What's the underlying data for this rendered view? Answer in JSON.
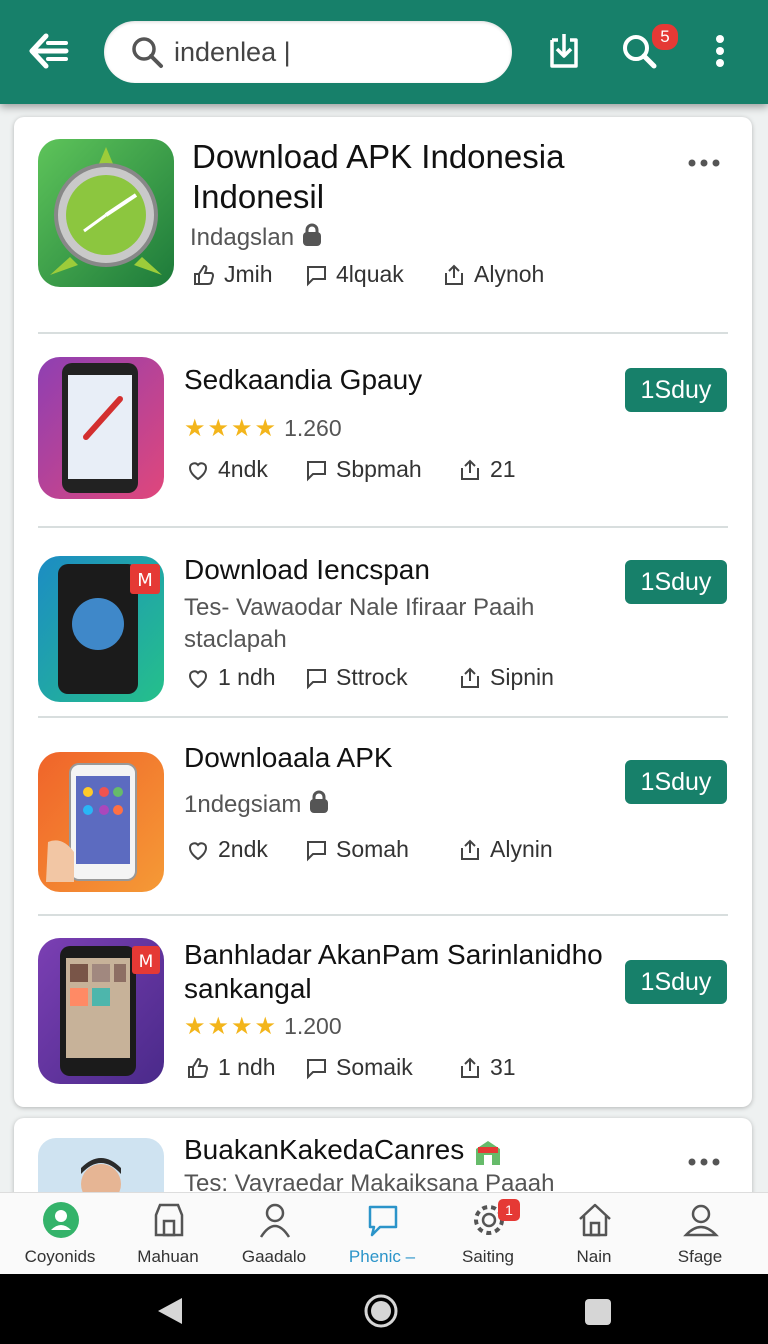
{
  "search": {
    "value": "indenlea |"
  },
  "toolbar": {
    "badge_count": "5"
  },
  "apps": [
    {
      "title": "Download APK Indonesia Indonesil",
      "subtitle": "Indagslan",
      "stats": [
        "Jmih",
        "4lquak",
        "Alynoh"
      ]
    },
    {
      "title": "Sedkaandia Gpauy",
      "rating_value": "1.260",
      "stats": [
        "4ndk",
        "Sbpmah",
        "21"
      ],
      "button": "1Sduy"
    },
    {
      "title": "Download Iencspan",
      "subtitle": "Tes- Vawaodar Nale Ifiraar Paaih staclapah",
      "stats": [
        "1 ndh",
        "Sttrock",
        "Sipnin"
      ],
      "button": "1Sduy"
    },
    {
      "title": "Downloaala APK",
      "subtitle": "1ndegsiam",
      "stats": [
        "2ndk",
        "Somah",
        "Alynin"
      ],
      "button": "1Sduy"
    },
    {
      "title": "Banhladar AkanPam Sarinlanidho sankangal",
      "rating_value": "1.200",
      "stats": [
        "1 ndh",
        "Somaik",
        "31"
      ],
      "button": "1Sduy"
    }
  ],
  "partial_item": {
    "title": "BuakanKakedaCanres",
    "subtitle": "Tes: Vayraedar Makaiksana Paaah"
  },
  "bottom_nav": [
    {
      "label": "Coyonids"
    },
    {
      "label": "Mahuan"
    },
    {
      "label": "Gaadalo"
    },
    {
      "label": "Phenic –"
    },
    {
      "label": "Saiting",
      "badge": "1"
    },
    {
      "label": "Nain"
    },
    {
      "label": "Sfage"
    }
  ],
  "colors": {
    "primary": "#17806a",
    "star": "#f3b51b",
    "badge": "#e53935",
    "active_nav": "#2b94c9"
  }
}
